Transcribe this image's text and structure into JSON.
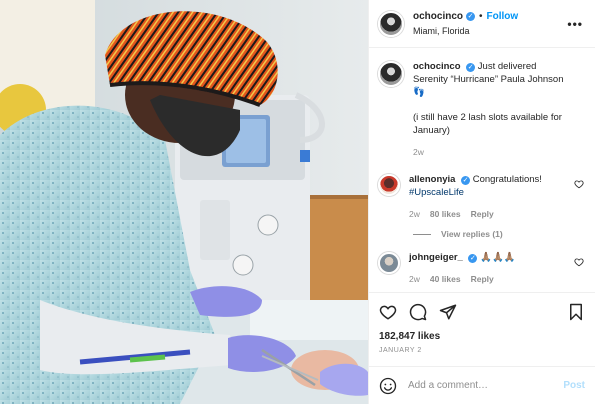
{
  "header": {
    "username": "ochocinco",
    "follow_label": "Follow",
    "location": "Miami, Florida",
    "more_label": "•••",
    "verified_mark": "✓"
  },
  "caption": {
    "username": "ochocinco",
    "line1": "Just delivered Serenity “Hurricane” Paula Johnson 👣",
    "line2": "(i still have 2 lash slots available for January)",
    "time": "2w"
  },
  "comments": [
    {
      "username": "allenonyia",
      "text": "Congratulations!",
      "hashtag": "#UpscaleLife",
      "time": "2w",
      "likes": "80 likes",
      "reply": "Reply"
    },
    {
      "username": "johngeiger_",
      "text": "🙏🏽🙏🏽🙏🏽",
      "time": "2w",
      "likes": "40 likes",
      "reply": "Reply"
    }
  ],
  "view_replies": "View replies (1)",
  "actions": {
    "likes_count": "182,847 likes",
    "date": "JANUARY 2"
  },
  "add_comment": {
    "placeholder": "Add a comment…",
    "post_label": "Post"
  },
  "colors": {
    "link_blue": "#0095f6",
    "post_disabled": "#b2dffc",
    "muted": "#8e8e8e"
  }
}
